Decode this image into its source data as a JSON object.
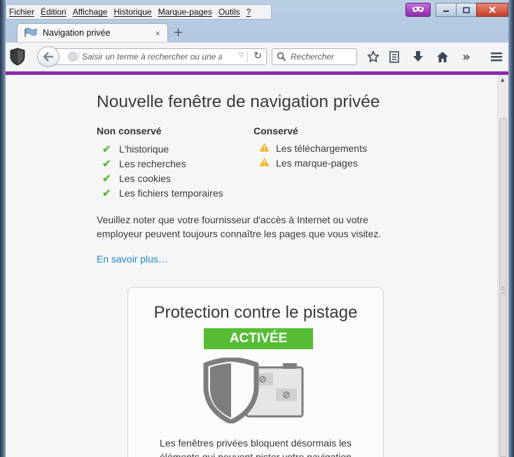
{
  "menubar": {
    "items": [
      "Fichier",
      "Édition",
      "Affichage",
      "Historique",
      "Marque-pages",
      "Outils",
      "?"
    ]
  },
  "tab": {
    "title": "Navigation privée",
    "close_glyph": "×",
    "new_tab_glyph": "+"
  },
  "toolbar": {
    "url_placeholder": "Saisir un terme à rechercher ou une adre",
    "search_placeholder": "Rechercher",
    "icons": [
      "private-mask-icon",
      "back-icon",
      "globe-icon",
      "reload-icon",
      "search-icon",
      "bookmark-star-icon",
      "reading-list-icon",
      "download-icon",
      "home-icon",
      "overflow-icon",
      "hamburger-menu-icon"
    ]
  },
  "colors": {
    "private_accent": "#8d2aa9",
    "check_green": "#57bd35",
    "warn_yellow": "#f2b322",
    "link_blue": "#1e88c8"
  },
  "page": {
    "title": "Nouvelle fenêtre de navigation privée",
    "not_kept": {
      "heading": "Non conservé",
      "items": [
        "L'historique",
        "Les recherches",
        "Les cookies",
        "Les fichiers temporaires"
      ]
    },
    "kept": {
      "heading": "Conservé",
      "items": [
        "Les téléchargements",
        "Les marque-pages"
      ]
    },
    "notice": "Veuillez noter que votre fournisseur d'accès à Internet ou votre employeur peuvent toujours connaître les pages que vous visitez.",
    "learn_more": "En savoir plus…"
  },
  "tracking": {
    "title": "Protection contre le pistage",
    "status": "ACTIVÉE",
    "description": "Les fenêtres privées bloquent désormais les éléments qui peuvent pister votre navigation"
  }
}
